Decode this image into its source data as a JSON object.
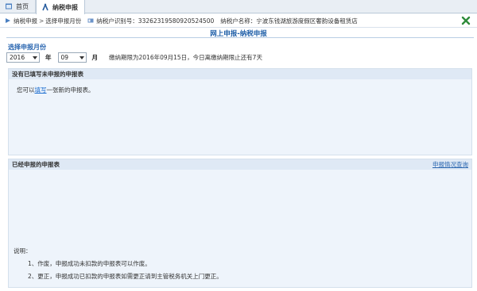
{
  "tabs": {
    "home_label": "首页",
    "active_label": "纳税申报"
  },
  "infobar": {
    "crumb_1": "纳税申报",
    "crumb_sep": ">",
    "crumb_2": "选择申报月份",
    "taxpayer_id_label": "纳税户识别号：",
    "taxpayer_id": "332623195809205245​00",
    "taxpayer_name_label": "纳税户名称：",
    "taxpayer_name": "宁波东钱湖旅游度假区奢韵设备租赁店"
  },
  "page": {
    "title": "网上申报-纳税申报",
    "select_month_label": "选择申报月份"
  },
  "controls": {
    "year_value": "2016",
    "year_unit": "年",
    "month_value": "09",
    "month_unit": "月",
    "deadline_text": "缴纳期限为2016年09月15日，今日离缴纳期限止还有7天"
  },
  "panel_unfilled": {
    "title": "没有已填写未申报的申报表",
    "text_before": "您可以",
    "fill_link": "填写",
    "text_after": "一张新的申报表。"
  },
  "panel_filed": {
    "title": "已经申报的申报表",
    "query_link": "申报情况查询"
  },
  "notes": {
    "title": "说明：",
    "items": [
      "1、作废，申报成功未扣款的申报表可以作废。",
      "2、更正，申报成功已扣款的申报表如需更正请到主管税务机关上门更正。"
    ]
  },
  "colors": {
    "accent": "#1f5fa8",
    "panel_bg": "#eef4fb",
    "panel_head_bg": "#dfe9f5",
    "close_icon": "#2e8b3a"
  }
}
